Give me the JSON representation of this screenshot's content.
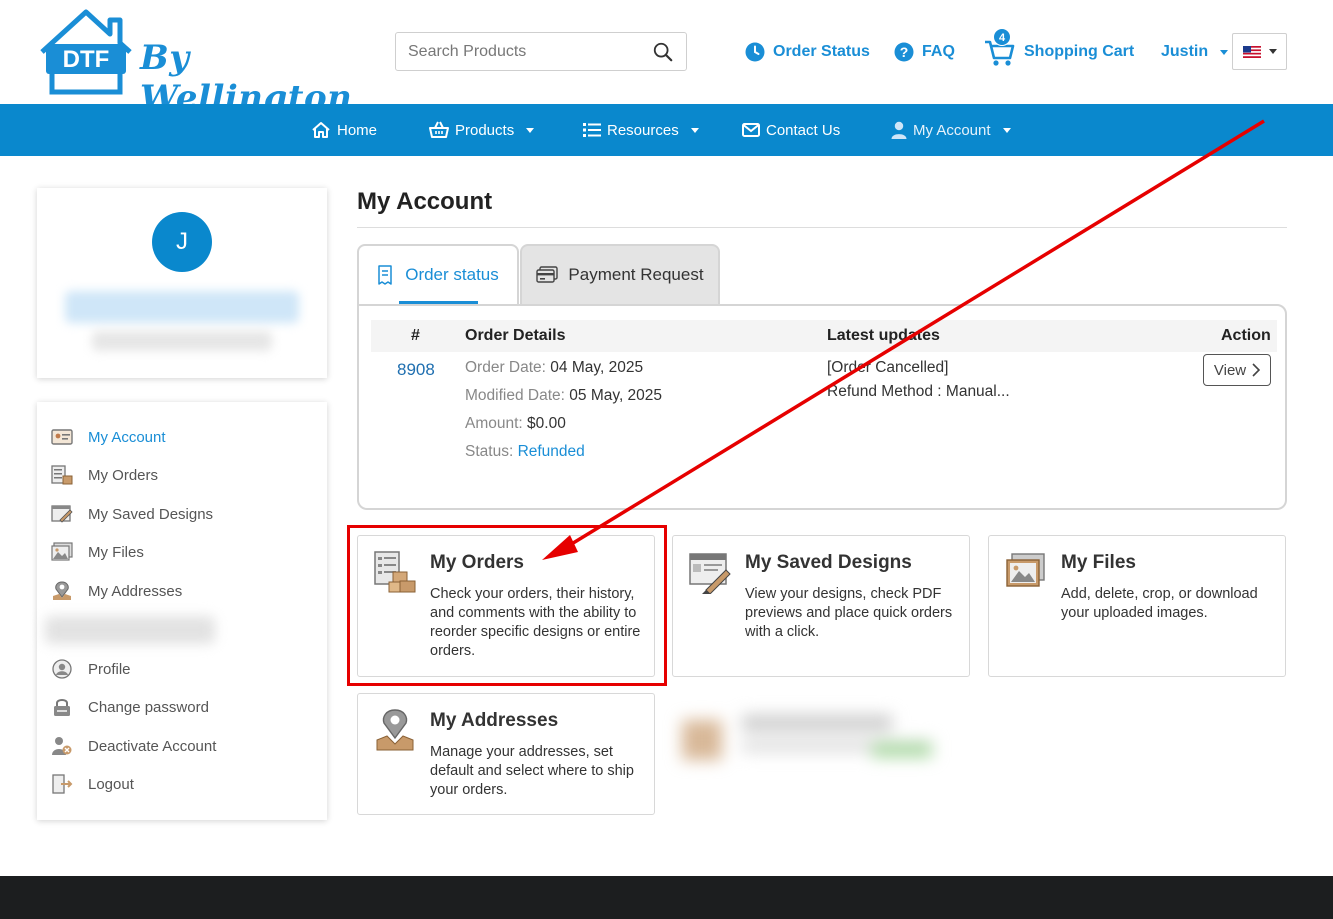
{
  "header": {
    "logo_text": "By Wellington",
    "logo_mark": "DTF",
    "search_placeholder": "Search Products",
    "order_status": "Order Status",
    "faq": "FAQ",
    "cart_label": "Shopping Cart",
    "cart_count": "4",
    "user": "Justin",
    "flag": "us-flag-icon"
  },
  "nav": {
    "items": [
      {
        "label": "Home",
        "icon": "home-icon"
      },
      {
        "label": "Products",
        "icon": "basket-icon"
      },
      {
        "label": "Resources",
        "icon": "list-icon"
      },
      {
        "label": "Contact Us",
        "icon": "envelope-icon"
      },
      {
        "label": "My Account",
        "icon": "user-icon"
      }
    ]
  },
  "profile": {
    "initial": "J"
  },
  "sidebar": {
    "items": [
      {
        "label": "My Account",
        "active": true
      },
      {
        "label": "My Orders"
      },
      {
        "label": "My Saved Designs"
      },
      {
        "label": "My Files"
      },
      {
        "label": "My Addresses"
      },
      {
        "label": "Profile"
      },
      {
        "label": "Change password"
      },
      {
        "label": "Deactivate Account"
      },
      {
        "label": "Logout"
      }
    ]
  },
  "main": {
    "title": "My Account",
    "tabs": [
      {
        "label": "Order status",
        "active": true
      },
      {
        "label": "Payment Request"
      }
    ],
    "table": {
      "headers": [
        "#",
        "Order Details",
        "Latest updates",
        "Action"
      ],
      "row": {
        "number": "8908",
        "order_date_label": "Order Date:",
        "order_date": "04 May, 2025",
        "modified_date_label": "Modified Date:",
        "modified_date": "05 May, 2025",
        "amount_label": "Amount:",
        "amount": "$0.00",
        "status_label": "Status:",
        "status": "Refunded",
        "update_line1": "[Order Cancelled]",
        "update_line2": "Refund Method : Manual...",
        "action": "View"
      }
    },
    "cards": [
      {
        "title": "My Orders",
        "desc": "Check your orders, their history, and comments with the ability to reorder specific designs or entire orders."
      },
      {
        "title": "My Saved Designs",
        "desc": "View your designs, check PDF previews and place quick orders with a click."
      },
      {
        "title": "My Files",
        "desc": "Add, delete, crop, or download your uploaded images."
      },
      {
        "title": "My Addresses",
        "desc": "Manage your addresses, set default and select where to ship your orders."
      }
    ]
  },
  "colors": {
    "brand_blue": "#0a88cd",
    "link_blue": "#1a8ed6",
    "highlight_red": "#e60000",
    "footer": "#1c1e1f"
  }
}
